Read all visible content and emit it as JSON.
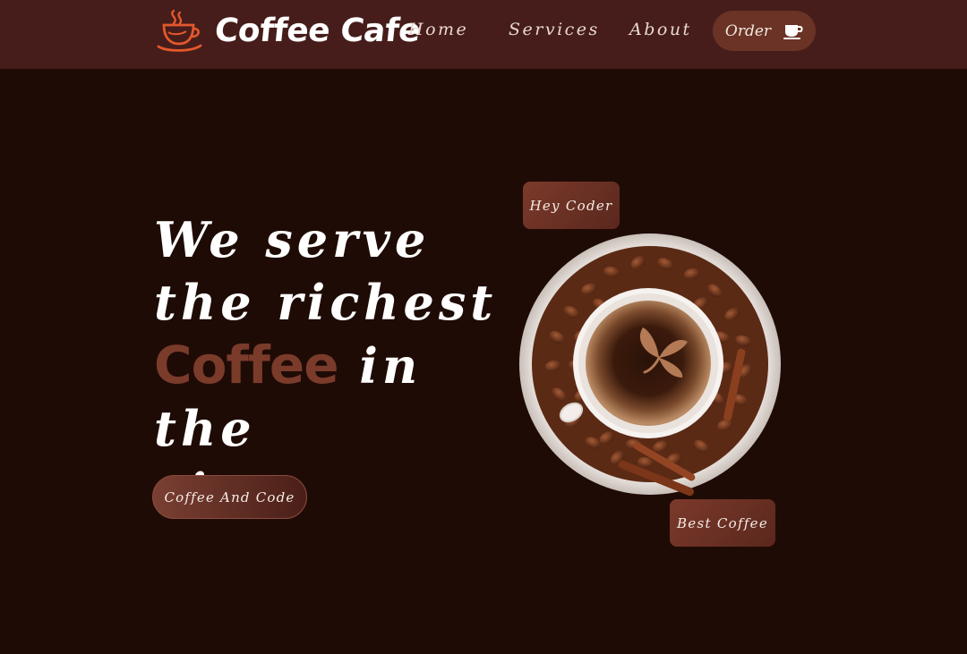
{
  "nav": {
    "brand": "Coffee Cafe",
    "links": [
      "Home",
      "Services",
      "About"
    ],
    "order_label": "Order"
  },
  "hero": {
    "line1": "We serve",
    "line2": "the richest",
    "accent": "Coffee",
    "line3_rest": " in the",
    "line4": "city",
    "cta_label": "Coffee And Code"
  },
  "badges": {
    "top": "Hey Coder",
    "bottom": "Best Coffee"
  },
  "icons": {
    "logo": "coffee-cup-logo-icon",
    "order": "coffee-cup-icon",
    "hero_image": "coffee-cup-with-beans-image"
  },
  "colors": {
    "background": "#1f0b05",
    "navbar": "#461d1b",
    "accent": "#7a3b2b",
    "logo_orange": "#e4582c"
  }
}
